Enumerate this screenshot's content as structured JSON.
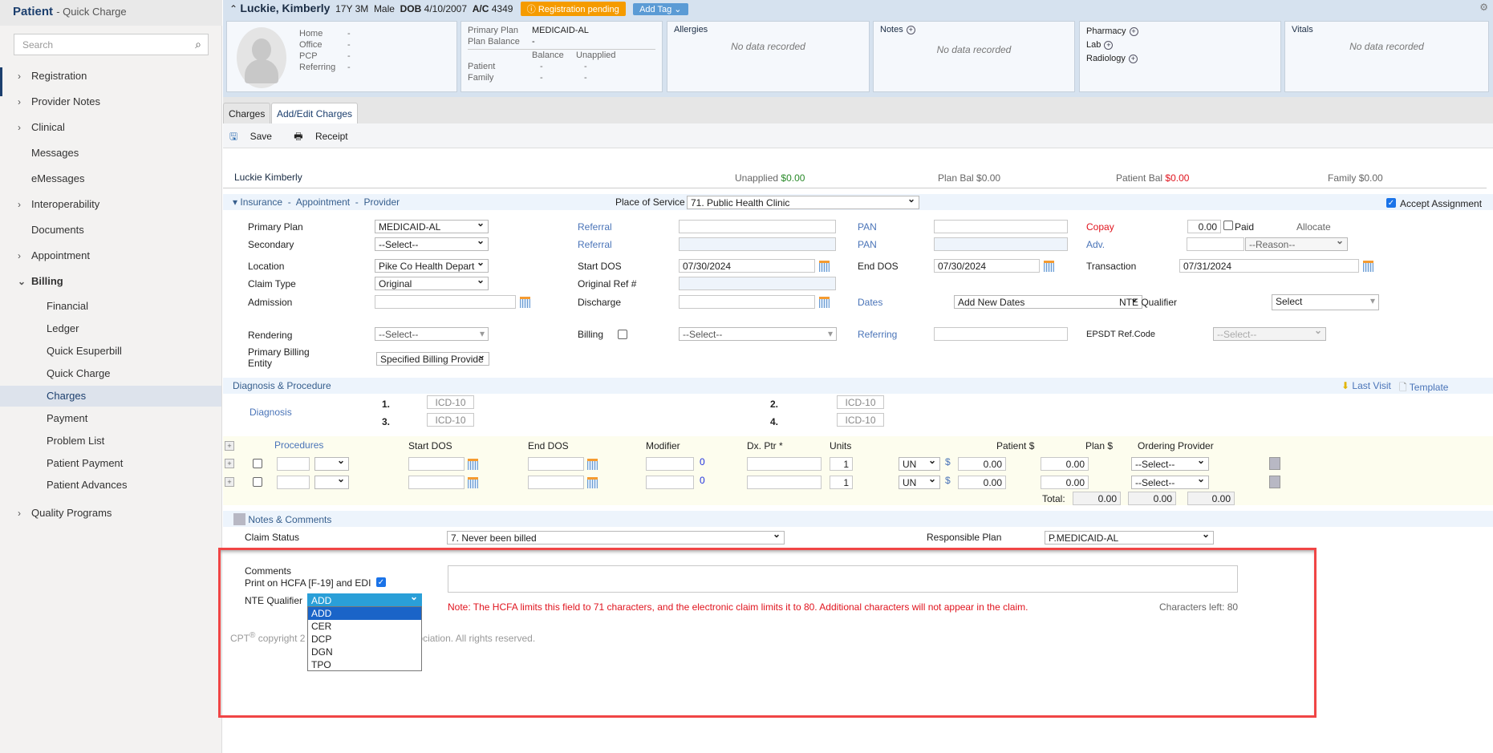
{
  "sidebar": {
    "title": "Patient",
    "subtitle": "- Quick Charge",
    "search_placeholder": "Search",
    "items": [
      {
        "label": "Registration",
        "chevron": "right"
      },
      {
        "label": "Provider Notes",
        "chevron": "right"
      },
      {
        "label": "Clinical",
        "chevron": "right"
      },
      {
        "label": "Messages"
      },
      {
        "label": "eMessages"
      },
      {
        "label": "Interoperability",
        "chevron": "right"
      },
      {
        "label": "Documents"
      },
      {
        "label": "Appointment",
        "chevron": "right"
      },
      {
        "label": "Billing",
        "chevron": "down"
      }
    ],
    "billing_items": [
      "Financial",
      "Ledger",
      "Quick Esuperbill",
      "Quick Charge",
      "Charges",
      "Payment",
      "Problem List",
      "Patient Payment",
      "Patient Advances"
    ],
    "active": "Charges",
    "footer_item": "Quality Programs"
  },
  "patient": {
    "name": "Luckie, Kimberly",
    "age": "17Y 3M",
    "sex": "Male",
    "dob_label": "DOB",
    "dob": "4/10/2007",
    "ac_label": "A/C",
    "ac": "4349",
    "status_badge": "Registration pending",
    "add_tag": "Add Tag",
    "contact": [
      {
        "k": "Home",
        "v": "-"
      },
      {
        "k": "Office",
        "v": "-"
      },
      {
        "k": "PCP",
        "v": "-"
      },
      {
        "k": "Referring",
        "v": "-"
      }
    ],
    "plan": {
      "primary_label": "Primary Plan",
      "primary": "MEDICAID-AL",
      "balance_label": "Plan Balance",
      "balance": "-",
      "col1": "Balance",
      "col2": "Unapplied",
      "patient_label": "Patient",
      "patient_bal": "-",
      "patient_unap": "-",
      "family_label": "Family",
      "family_bal": "-",
      "family_unap": "-"
    },
    "allergies": "Allergies",
    "notes": "Notes",
    "pharmacy": "Pharmacy",
    "lab": "Lab",
    "radiology": "Radiology",
    "vitals": "Vitals",
    "no_data": "No data recorded"
  },
  "colors": {
    "badge": "#f59b00",
    "tag": "#5b9bd5",
    "accent": "#1c3f6e",
    "highlight": "#f04545"
  },
  "tabs": [
    "Charges",
    "Add/Edit Charges"
  ],
  "toolbar": {
    "save": "Save",
    "receipt": "Receipt"
  },
  "summary": {
    "name": "Luckie Kimberly",
    "unapplied_label": "Unapplied",
    "unapplied": "$0.00",
    "planbal_label": "Plan Bal",
    "planbal": "$0.00",
    "patbal_label": "Patient Bal",
    "patbal": "$0.00",
    "family_label": "Family",
    "family": "$0.00"
  },
  "insurance": {
    "section": "Insurance  -  Appointment  -  Provider",
    "pos_label": "Place of Service",
    "pos": "71. Public Health Clinic",
    "accept": "Accept Assignment",
    "primary_plan_label": "Primary Plan",
    "primary_plan": "MEDICAID-AL",
    "secondary_label": "Secondary",
    "secondary": "--Select--",
    "location_label": "Location",
    "location": "Pike Co Health Depart",
    "claim_type_label": "Claim Type",
    "claim_type": "Original",
    "admission_label": "Admission",
    "rendering_label": "Rendering",
    "rendering": "--Select--",
    "pbe_label": "Primary Billing Entity",
    "pbe": "Specified Billing Provide",
    "referral_label": "Referral",
    "start_dos_label": "Start DOS",
    "start_dos": "07/30/2024",
    "orig_ref_label": "Original Ref #",
    "discharge_label": "Discharge",
    "billing_label": "Billing",
    "billing": "--Select--",
    "pan_label": "PAN",
    "end_dos_label": "End DOS",
    "end_dos": "07/30/2024",
    "dates_label": "Dates",
    "dates": "Add New Dates",
    "referring_label": "Referring",
    "copay_label": "Copay",
    "copay": "0.00",
    "paid": "Paid",
    "allocate": "Allocate",
    "adv_label": "Adv.",
    "reason": "--Reason--",
    "transaction_label": "Transaction",
    "transaction": "07/31/2024",
    "nte_label": "NTE Qualifier",
    "nte": "Select",
    "epsdt_label": "EPSDT Ref.Code",
    "epsdt": "--Select--"
  },
  "diagnosis": {
    "section": "Diagnosis & Procedure",
    "last_visit": "Last Visit",
    "template": "Template",
    "label": "Diagnosis",
    "placeholder": "ICD-10",
    "nums": [
      "1.",
      "2.",
      "3.",
      "4."
    ]
  },
  "procedures": {
    "headers": [
      "Procedures",
      "Start DOS",
      "End DOS",
      "Modifier",
      "Dx. Ptr *",
      "Units",
      "Patient $",
      "Plan $",
      "Ordering Provider"
    ],
    "rows": [
      {
        "mod_count": "0",
        "units": "1",
        "unit_type": "UN",
        "currency": "$",
        "patient": "0.00",
        "plan": "0.00",
        "provider": "--Select--"
      },
      {
        "mod_count": "0",
        "units": "1",
        "unit_type": "UN",
        "currency": "$",
        "patient": "0.00",
        "plan": "0.00",
        "provider": "--Select--"
      }
    ],
    "total_label": "Total:",
    "totals": [
      "0.00",
      "0.00",
      "0.00"
    ]
  },
  "notes": {
    "section": "Notes & Comments",
    "claim_status_label": "Claim Status",
    "claim_status": "7. Never been billed",
    "resp_plan_label": "Responsible Plan",
    "resp_plan": "P.MEDICAID-AL",
    "comments_label": "Comments",
    "print_label": "Print on HCFA [F-19] and EDI",
    "nte_label": "NTE Qualifier",
    "nte_value": "ADD",
    "nte_options": [
      "ADD",
      "CER",
      "DCP",
      "DGN",
      "TPO"
    ],
    "note": "Note: The HCFA limits this field to 71 characters, and the electronic claim limits it to 80. Additional characters will not appear in the claim.",
    "chars_left": "Characters left: 80"
  },
  "footer": {
    "cpt_pre": "CPT",
    "cpt_post": "copyright 2",
    "cpt_tail": "ociation. All rights reserved."
  }
}
